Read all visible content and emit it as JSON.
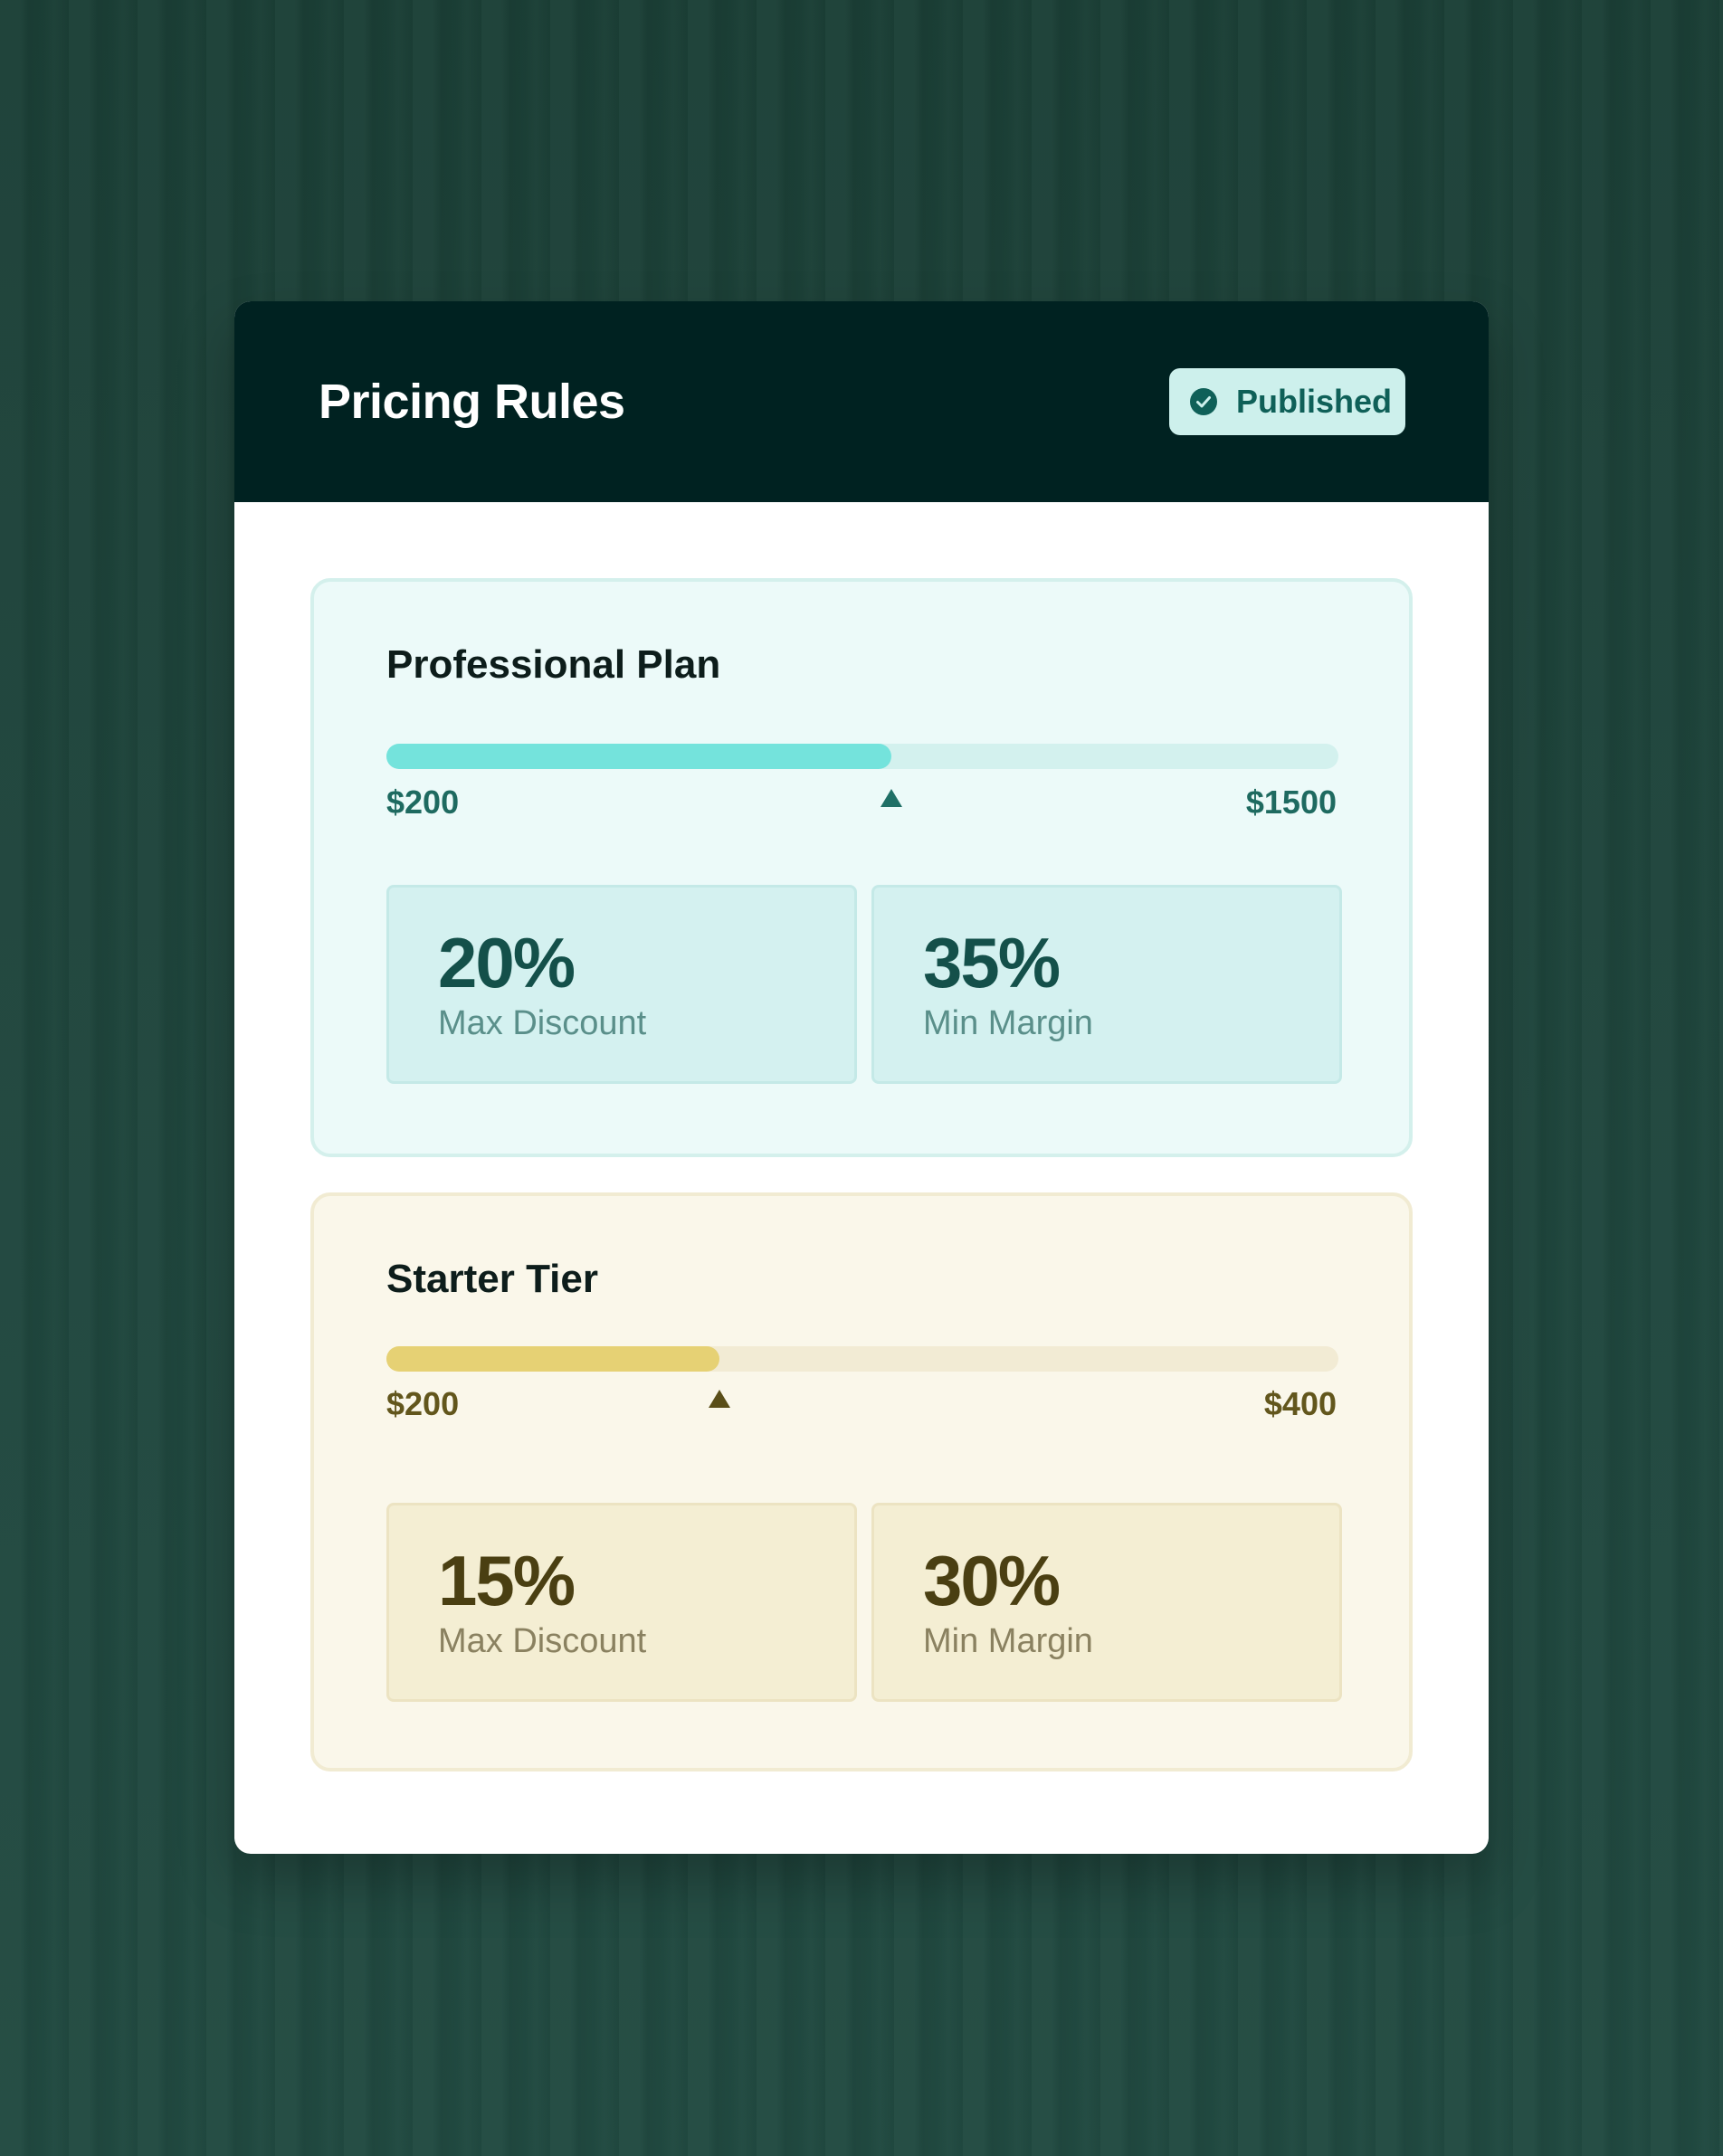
{
  "panel": {
    "title": "Pricing Rules",
    "status_badge": {
      "label": "Published",
      "icon": "check-circle-icon"
    }
  },
  "plans": [
    {
      "name": "Professional Plan",
      "range_min_label": "$200",
      "range_max_label": "$1500",
      "range_fill_fraction": 0.53,
      "accent_color": "#74e3dc",
      "stats": [
        {
          "value": "20%",
          "label": "Max Discount"
        },
        {
          "value": "35%",
          "label": "Min Margin"
        }
      ]
    },
    {
      "name": "Starter Tier",
      "range_min_label": "$200",
      "range_max_label": "$400",
      "range_fill_fraction": 0.35,
      "accent_color": "#e6d174",
      "stats": [
        {
          "value": "15%",
          "label": "Max Discount"
        },
        {
          "value": "30%",
          "label": "Min Margin"
        }
      ]
    }
  ]
}
